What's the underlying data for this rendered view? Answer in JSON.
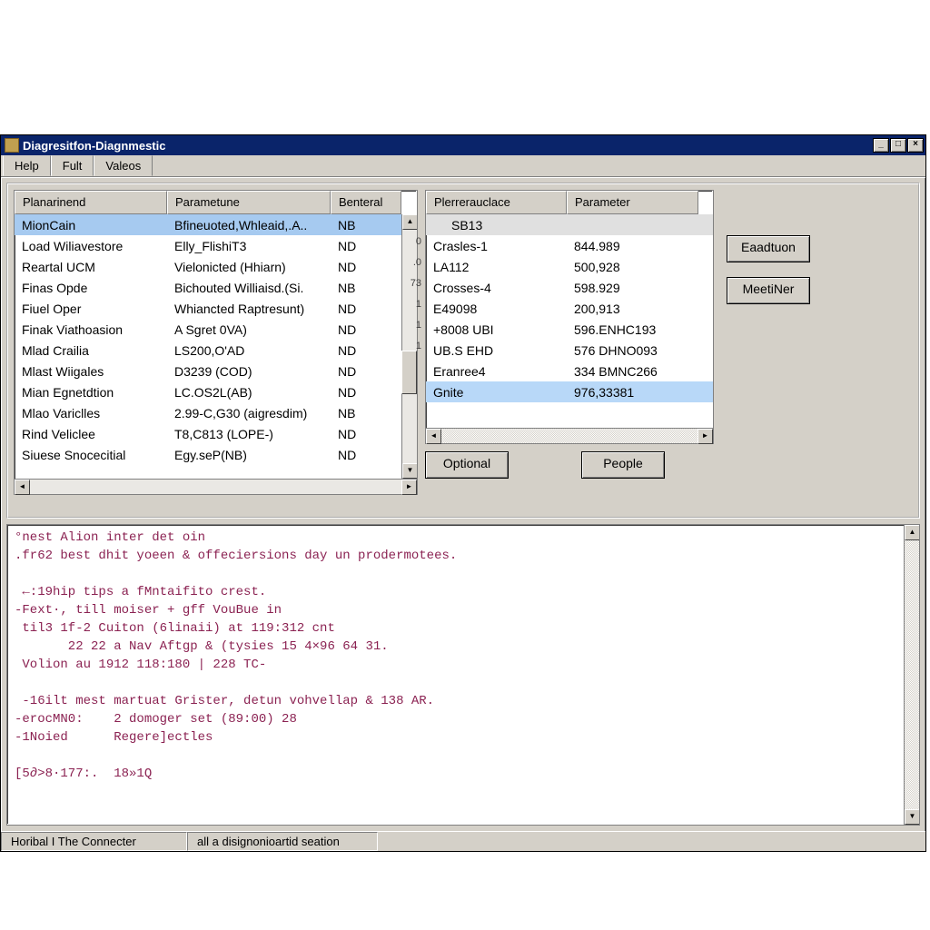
{
  "window": {
    "title": "Diagresitfon-Diagnmestic"
  },
  "menu": {
    "items": [
      "Help",
      "Fult",
      "Valeos"
    ]
  },
  "leftTable": {
    "headers": [
      "Planarinend",
      "Parametune",
      "Benteral"
    ],
    "rows": [
      {
        "c0": "MionCain",
        "c1": "Bfineuoted,Whleaid,.A..",
        "c2": "NB",
        "sel": true
      },
      {
        "c0": "Load Wiliavestore",
        "c1": "Elly_FlishiT3",
        "c2": "ND"
      },
      {
        "c0": "Reartal UCM",
        "c1": "Vielonicted (Hhiarn)",
        "c2": "ND"
      },
      {
        "c0": "Finas Opde",
        "c1": "Bichouted Williaisd.(Si.",
        "c2": "NB"
      },
      {
        "c0": "Fiuel Oper",
        "c1": "Whiancted Raptresunt)",
        "c2": "ND"
      },
      {
        "c0": "Finak Viathoasion",
        "c1": "A Sgret 0VA)",
        "c2": "ND"
      },
      {
        "c0": "Mlad Crailia",
        "c1": "LS200,O'AD",
        "c2": "ND"
      },
      {
        "c0": "Mlast Wiigales",
        "c1": "D3239 (COD)",
        "c2": "ND"
      },
      {
        "c0": "Mian Egnetdtion",
        "c1": "LC.OS2L(AB)",
        "c2": "ND"
      },
      {
        "c0": "Mlao Variclles",
        "c1": "2.99-C,G30 (aigresdim)",
        "c2": "NB"
      },
      {
        "c0": "Rind Veliclee",
        "c1": "T8,C813 (LOPE-)",
        "c2": "ND"
      },
      {
        "c0": "Siuese Snocecitial",
        "c1": "Egy.seP(NB)",
        "c2": "ND"
      }
    ]
  },
  "rightTable": {
    "headers": [
      "Plerrerauclace",
      "Parameter"
    ],
    "subheader": "SB13",
    "rowNums": [
      "",
      "0",
      ".0",
      "73",
      "1",
      "1",
      "1",
      ""
    ],
    "rows": [
      {
        "c0": "Crasles-1",
        "c1": "844.989"
      },
      {
        "c0": "LA112",
        "c1": "500,928"
      },
      {
        "c0": "Crosses-4",
        "c1": "598.929"
      },
      {
        "c0": "E49098",
        "c1": "200,913"
      },
      {
        "c0": "+8008 UBI",
        "c1": "596.ENHC193"
      },
      {
        "c0": "UB.S EHD",
        "c1": "576 DHNO093"
      },
      {
        "c0": "Eranree4",
        "c1": "334 BMNC266"
      },
      {
        "c0": "Gnite",
        "c1": "976,33381",
        "sel": true
      }
    ]
  },
  "buttons": {
    "eaadtuon": "Eaadtuon",
    "meetiner": "MeetiNer",
    "optional": "Optional",
    "people": "People"
  },
  "log": {
    "lines": [
      "°nest Alion inter det oin",
      ".fr62 best dhit yoeen & offeciersions day un prodermotees.",
      "",
      " ←:19hip tips a fMntaifito crest.",
      "-Fext·, till moiser + gff VouBue in",
      " til3 1f-2 Cuiton (6linaii) at 119:312 cnt",
      "       22 22 a Nav Aftgp & (tysies 15 4×96 64 31.",
      " Volion au 1912 118:180 | 228 TC-",
      "",
      " -16ilt mest martuat Grister, detun vohvellap & 138 AR.",
      "-erocMN0:    2 domoger set (89:00) 28",
      "-1Noied      Regere]ectles",
      "",
      "[5∂>8·177:.  18»1Q"
    ]
  },
  "statusbar": {
    "cell1": "Horibal I The Connecter",
    "cell2": "all a disignonioartid seation"
  }
}
